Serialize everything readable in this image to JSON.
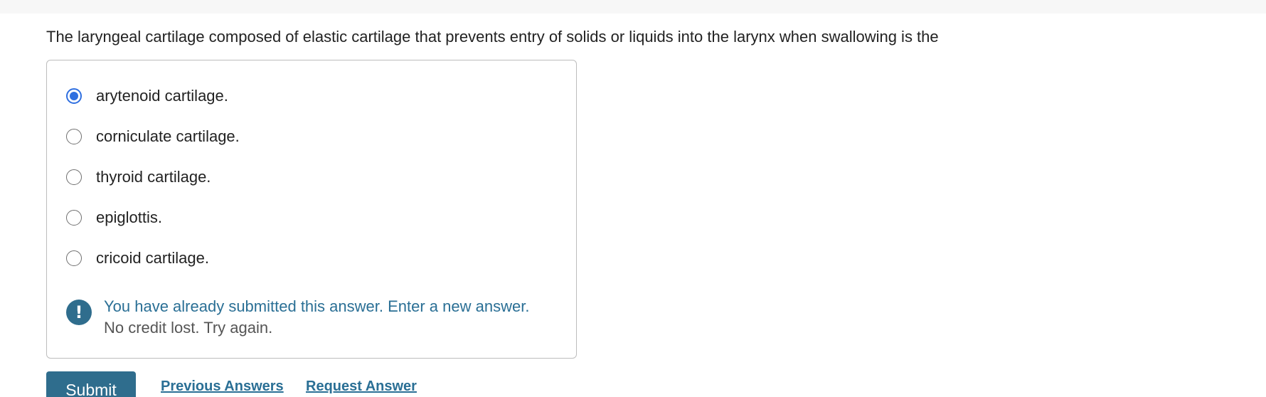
{
  "question": {
    "text": "The laryngeal cartilage composed of elastic cartilage that prevents entry of solids or liquids into the larynx when swallowing is the"
  },
  "options": [
    {
      "label": "arytenoid cartilage.",
      "selected": true
    },
    {
      "label": "corniculate cartilage.",
      "selected": false
    },
    {
      "label": "thyroid cartilage.",
      "selected": false
    },
    {
      "label": "epiglottis.",
      "selected": false
    },
    {
      "label": "cricoid cartilage.",
      "selected": false
    }
  ],
  "feedback": {
    "icon": "exclamation-icon",
    "message": "You have already submitted this answer. Enter a new answer.",
    "submessage": "No credit lost. Try again."
  },
  "actions": {
    "submit_label": "Submit",
    "previous_answers_label": "Previous Answers",
    "request_answer_label": "Request Answer"
  },
  "colors": {
    "accent": "#2f6d8d",
    "radio_selected": "#2f6fe0",
    "feedback_text": "#2a6f95"
  }
}
